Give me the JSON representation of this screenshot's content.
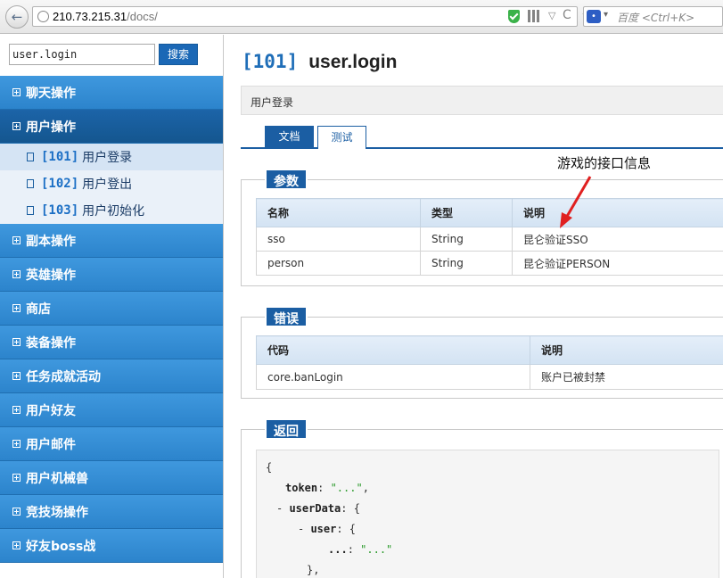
{
  "browser": {
    "url_host": "210.73.215.31",
    "url_path": "/docs/",
    "search_placeholder": "百度 <Ctrl+K>"
  },
  "sidebar": {
    "search_value": "user.login",
    "search_button": "搜索",
    "menu": [
      {
        "label": "聊天操作"
      },
      {
        "label": "用户操作"
      },
      {
        "label": "副本操作"
      },
      {
        "label": "英雄操作"
      },
      {
        "label": "商店"
      },
      {
        "label": "装备操作"
      },
      {
        "label": "任务成就活动"
      },
      {
        "label": "用户好友"
      },
      {
        "label": "用户邮件"
      },
      {
        "label": "用户机械兽"
      },
      {
        "label": "竞技场操作"
      },
      {
        "label": "好友boss战"
      }
    ],
    "submenu": [
      {
        "code": "[101]",
        "name": "用户登录"
      },
      {
        "code": "[102]",
        "name": "用户登出"
      },
      {
        "code": "[103]",
        "name": "用户初始化"
      }
    ]
  },
  "main": {
    "code": "[101]",
    "name": "user.login",
    "description": "用户登录",
    "tabs": {
      "doc": "文档",
      "test": "测试"
    },
    "params": {
      "label": "参数",
      "headers": [
        "名称",
        "类型",
        "说明"
      ],
      "rows": [
        [
          "sso",
          "String",
          "昆仑验证SSO"
        ],
        [
          "person",
          "String",
          "昆仑验证PERSON"
        ]
      ]
    },
    "errors": {
      "label": "错误",
      "headers": [
        "代码",
        "说明"
      ],
      "rows": [
        [
          "core.banLogin",
          "账户已被封禁"
        ]
      ]
    },
    "returns": {
      "label": "返回",
      "open": "{",
      "token_key": "token",
      "token_val": "\"...\"",
      "userdata_key": "userData",
      "user_key": "user",
      "ellipsis_key": "...",
      "ellipsis_val": "\"...\"",
      "close": "},"
    }
  },
  "annotation": "游戏的接口信息",
  "colors": {
    "accent": "#1b5ea3",
    "menu": "#3f98de"
  }
}
